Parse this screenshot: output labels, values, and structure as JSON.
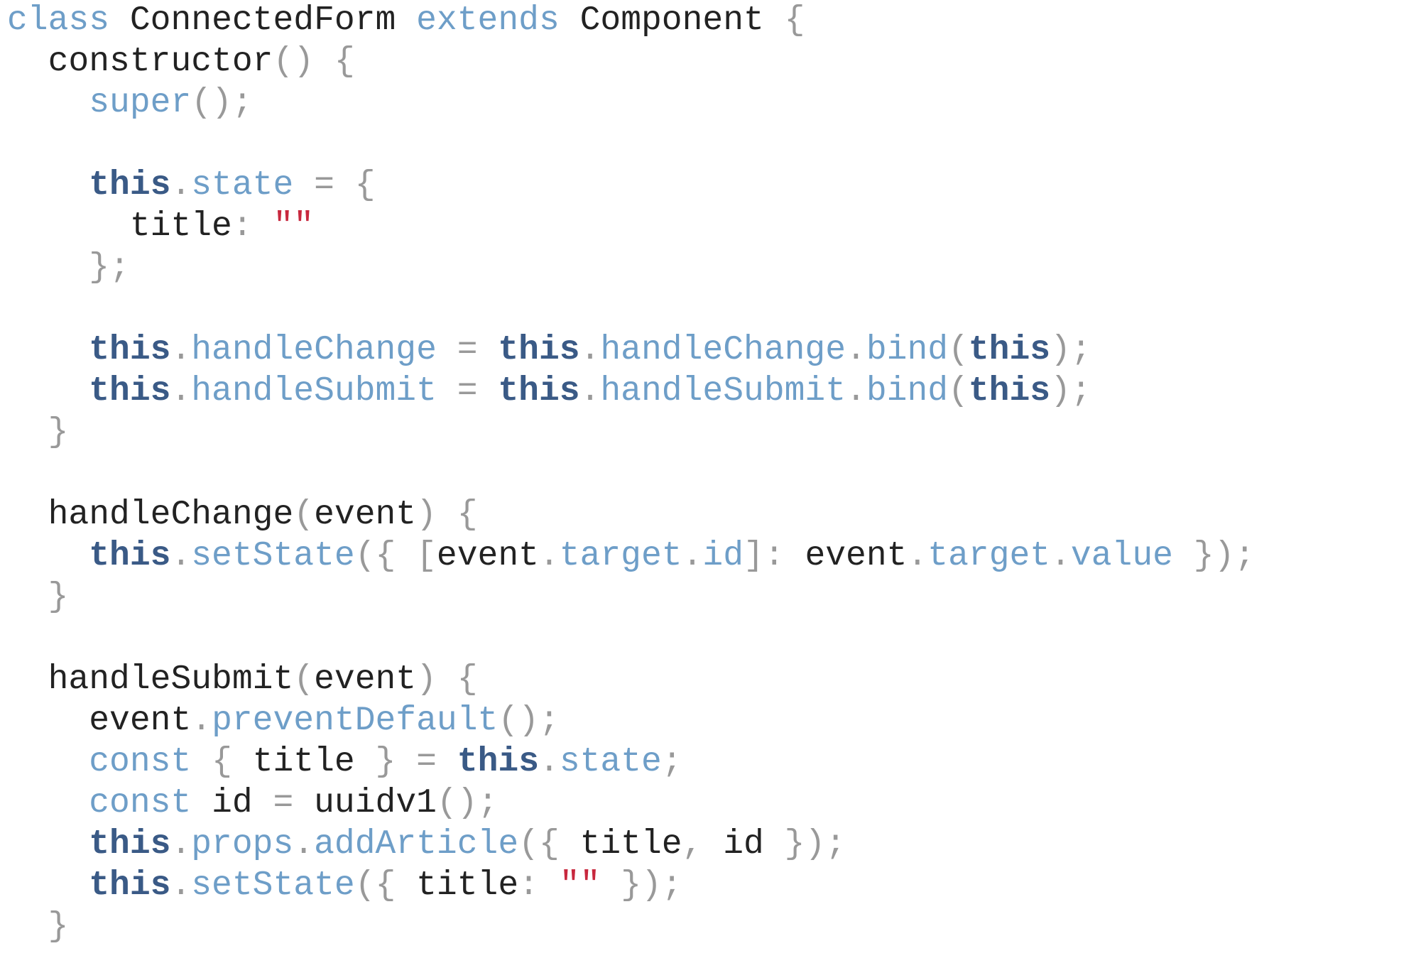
{
  "language": "javascript",
  "colors": {
    "keyword": "#6e9ec8",
    "this_keyword": "#3a5a86",
    "property": "#6e9ec8",
    "punctuation": "#999999",
    "string": "#c8283e",
    "identifier": "#222222"
  },
  "lines": [
    [
      [
        "kw",
        "class"
      ],
      [
        "text",
        " "
      ],
      [
        "id",
        "ConnectedForm"
      ],
      [
        "text",
        " "
      ],
      [
        "kw",
        "extends"
      ],
      [
        "text",
        " "
      ],
      [
        "id",
        "Component"
      ],
      [
        "text",
        " "
      ],
      [
        "punc",
        "{"
      ]
    ],
    [
      [
        "text",
        "  "
      ],
      [
        "id",
        "constructor"
      ],
      [
        "punc",
        "()"
      ],
      [
        "text",
        " "
      ],
      [
        "punc",
        "{"
      ]
    ],
    [
      [
        "text",
        "    "
      ],
      [
        "kw",
        "super"
      ],
      [
        "punc",
        "();"
      ]
    ],
    [],
    [
      [
        "text",
        "    "
      ],
      [
        "this",
        "this"
      ],
      [
        "punc",
        "."
      ],
      [
        "prop",
        "state"
      ],
      [
        "text",
        " "
      ],
      [
        "punc",
        "="
      ],
      [
        "text",
        " "
      ],
      [
        "punc",
        "{"
      ]
    ],
    [
      [
        "text",
        "      "
      ],
      [
        "id",
        "title"
      ],
      [
        "punc",
        ":"
      ],
      [
        "text",
        " "
      ],
      [
        "str",
        "\"\""
      ]
    ],
    [
      [
        "text",
        "    "
      ],
      [
        "punc",
        "};"
      ]
    ],
    [],
    [
      [
        "text",
        "    "
      ],
      [
        "this",
        "this"
      ],
      [
        "punc",
        "."
      ],
      [
        "prop",
        "handleChange"
      ],
      [
        "text",
        " "
      ],
      [
        "punc",
        "="
      ],
      [
        "text",
        " "
      ],
      [
        "this",
        "this"
      ],
      [
        "punc",
        "."
      ],
      [
        "prop",
        "handleChange"
      ],
      [
        "punc",
        "."
      ],
      [
        "prop",
        "bind"
      ],
      [
        "punc",
        "("
      ],
      [
        "this",
        "this"
      ],
      [
        "punc",
        ");"
      ]
    ],
    [
      [
        "text",
        "    "
      ],
      [
        "this",
        "this"
      ],
      [
        "punc",
        "."
      ],
      [
        "prop",
        "handleSubmit"
      ],
      [
        "text",
        " "
      ],
      [
        "punc",
        "="
      ],
      [
        "text",
        " "
      ],
      [
        "this",
        "this"
      ],
      [
        "punc",
        "."
      ],
      [
        "prop",
        "handleSubmit"
      ],
      [
        "punc",
        "."
      ],
      [
        "prop",
        "bind"
      ],
      [
        "punc",
        "("
      ],
      [
        "this",
        "this"
      ],
      [
        "punc",
        ");"
      ]
    ],
    [
      [
        "text",
        "  "
      ],
      [
        "punc",
        "}"
      ]
    ],
    [],
    [
      [
        "text",
        "  "
      ],
      [
        "id",
        "handleChange"
      ],
      [
        "punc",
        "("
      ],
      [
        "id",
        "event"
      ],
      [
        "punc",
        ")"
      ],
      [
        "text",
        " "
      ],
      [
        "punc",
        "{"
      ]
    ],
    [
      [
        "text",
        "    "
      ],
      [
        "this",
        "this"
      ],
      [
        "punc",
        "."
      ],
      [
        "prop",
        "setState"
      ],
      [
        "punc",
        "({"
      ],
      [
        "text",
        " "
      ],
      [
        "punc",
        "["
      ],
      [
        "id",
        "event"
      ],
      [
        "punc",
        "."
      ],
      [
        "prop",
        "target"
      ],
      [
        "punc",
        "."
      ],
      [
        "prop",
        "id"
      ],
      [
        "punc",
        "]:"
      ],
      [
        "text",
        " "
      ],
      [
        "id",
        "event"
      ],
      [
        "punc",
        "."
      ],
      [
        "prop",
        "target"
      ],
      [
        "punc",
        "."
      ],
      [
        "prop",
        "value"
      ],
      [
        "text",
        " "
      ],
      [
        "punc",
        "});"
      ]
    ],
    [
      [
        "text",
        "  "
      ],
      [
        "punc",
        "}"
      ]
    ],
    [],
    [
      [
        "text",
        "  "
      ],
      [
        "id",
        "handleSubmit"
      ],
      [
        "punc",
        "("
      ],
      [
        "id",
        "event"
      ],
      [
        "punc",
        ")"
      ],
      [
        "text",
        " "
      ],
      [
        "punc",
        "{"
      ]
    ],
    [
      [
        "text",
        "    "
      ],
      [
        "id",
        "event"
      ],
      [
        "punc",
        "."
      ],
      [
        "prop",
        "preventDefault"
      ],
      [
        "punc",
        "();"
      ]
    ],
    [
      [
        "text",
        "    "
      ],
      [
        "kw",
        "const"
      ],
      [
        "text",
        " "
      ],
      [
        "punc",
        "{"
      ],
      [
        "text",
        " "
      ],
      [
        "id",
        "title"
      ],
      [
        "text",
        " "
      ],
      [
        "punc",
        "}"
      ],
      [
        "text",
        " "
      ],
      [
        "punc",
        "="
      ],
      [
        "text",
        " "
      ],
      [
        "this",
        "this"
      ],
      [
        "punc",
        "."
      ],
      [
        "prop",
        "state"
      ],
      [
        "punc",
        ";"
      ]
    ],
    [
      [
        "text",
        "    "
      ],
      [
        "kw",
        "const"
      ],
      [
        "text",
        " "
      ],
      [
        "id",
        "id"
      ],
      [
        "text",
        " "
      ],
      [
        "punc",
        "="
      ],
      [
        "text",
        " "
      ],
      [
        "id",
        "uuidv1"
      ],
      [
        "punc",
        "();"
      ]
    ],
    [
      [
        "text",
        "    "
      ],
      [
        "this",
        "this"
      ],
      [
        "punc",
        "."
      ],
      [
        "prop",
        "props"
      ],
      [
        "punc",
        "."
      ],
      [
        "prop",
        "addArticle"
      ],
      [
        "punc",
        "({"
      ],
      [
        "text",
        " "
      ],
      [
        "id",
        "title"
      ],
      [
        "punc",
        ","
      ],
      [
        "text",
        " "
      ],
      [
        "id",
        "id"
      ],
      [
        "text",
        " "
      ],
      [
        "punc",
        "});"
      ]
    ],
    [
      [
        "text",
        "    "
      ],
      [
        "this",
        "this"
      ],
      [
        "punc",
        "."
      ],
      [
        "prop",
        "setState"
      ],
      [
        "punc",
        "({"
      ],
      [
        "text",
        " "
      ],
      [
        "id",
        "title"
      ],
      [
        "punc",
        ":"
      ],
      [
        "text",
        " "
      ],
      [
        "str",
        "\"\""
      ],
      [
        "text",
        " "
      ],
      [
        "punc",
        "});"
      ]
    ],
    [
      [
        "text",
        "  "
      ],
      [
        "punc",
        "}"
      ]
    ]
  ]
}
